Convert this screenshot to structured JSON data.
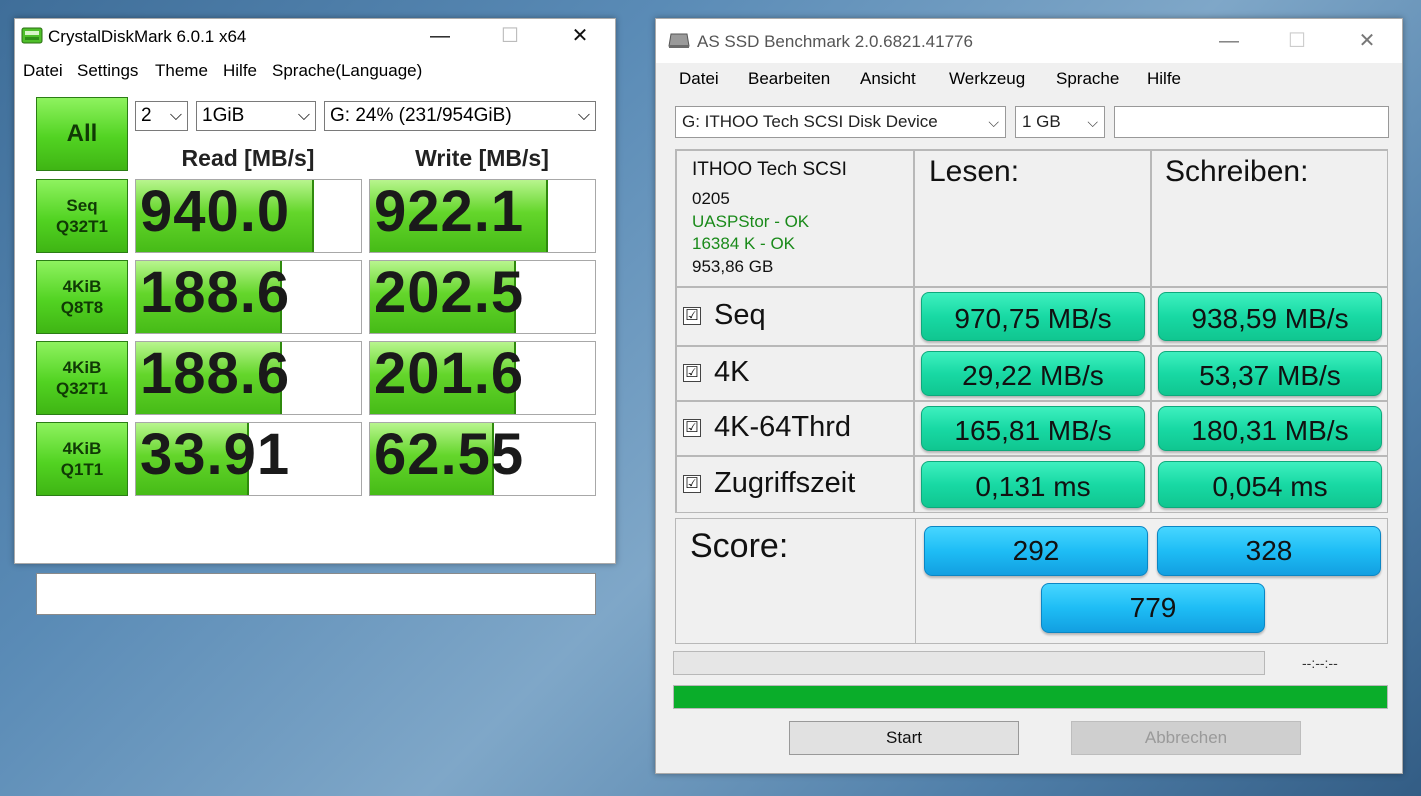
{
  "cdm": {
    "title": "CrystalDiskMark 6.0.1 x64",
    "window_controls": {
      "minimize": "—",
      "maximize": "☐",
      "close": "✕"
    },
    "menu": [
      "Datei",
      "Settings",
      "Theme",
      "Hilfe",
      "Sprache(Language)"
    ],
    "all_button": "All",
    "count_select": "2",
    "size_select": "1GiB",
    "drive_select": "G: 24% (231/954GiB)",
    "read_header": "Read [MB/s]",
    "write_header": "Write [MB/s]",
    "rows": [
      {
        "label1": "Seq",
        "label2": "Q32T1",
        "read": "940.0",
        "write": "922.1",
        "read_fill": 0.79,
        "write_fill": 0.79
      },
      {
        "label1": "4KiB",
        "label2": "Q8T8",
        "read": "188.6",
        "write": "202.5",
        "read_fill": 0.65,
        "write_fill": 0.65
      },
      {
        "label1": "4KiB",
        "label2": "Q32T1",
        "read": "188.6",
        "write": "201.6",
        "read_fill": 0.65,
        "write_fill": 0.65
      },
      {
        "label1": "4KiB",
        "label2": "Q1T1",
        "read": "33.91",
        "write": "62.55",
        "read_fill": 0.5,
        "write_fill": 0.55
      }
    ],
    "colors": {
      "accent_green": "#52d322"
    }
  },
  "asssd": {
    "title": "AS SSD Benchmark 2.0.6821.41776",
    "window_controls": {
      "minimize": "—",
      "maximize": "☐",
      "close": "✕"
    },
    "menu": [
      "Datei",
      "Bearbeiten",
      "Ansicht",
      "Werkzeug",
      "Sprache",
      "Hilfe"
    ],
    "drive_select": "G: ITHOO Tech SCSI Disk Device",
    "size_select": "1 GB",
    "info": {
      "name": "ITHOO Tech SCSI",
      "firmware": "0205",
      "driver": "UASPStor - OK",
      "alignment": "16384 K - OK",
      "capacity": "953,86 GB"
    },
    "read_header": "Lesen:",
    "write_header": "Schreiben:",
    "rows": [
      {
        "label": "Seq",
        "checked": "☑",
        "read": "970,75 MB/s",
        "write": "938,59 MB/s"
      },
      {
        "label": "4K",
        "checked": "☑",
        "read": "29,22 MB/s",
        "write": "53,37 MB/s"
      },
      {
        "label": "4K-64Thrd",
        "checked": "☑",
        "read": "165,81 MB/s",
        "write": "180,31 MB/s"
      },
      {
        "label": "Zugriffszeit",
        "checked": "☑",
        "read": "0,131 ms",
        "write": "0,054 ms"
      }
    ],
    "score_label": "Score:",
    "score_read": "292",
    "score_write": "328",
    "score_total": "779",
    "time": "--:--:--",
    "progress": 1.0,
    "start_button": "Start",
    "abort_button": "Abbrechen",
    "colors": {
      "green_pill": "#18d9a4",
      "blue_pill": "#1ebdf5",
      "progress": "#0aad2a"
    }
  }
}
